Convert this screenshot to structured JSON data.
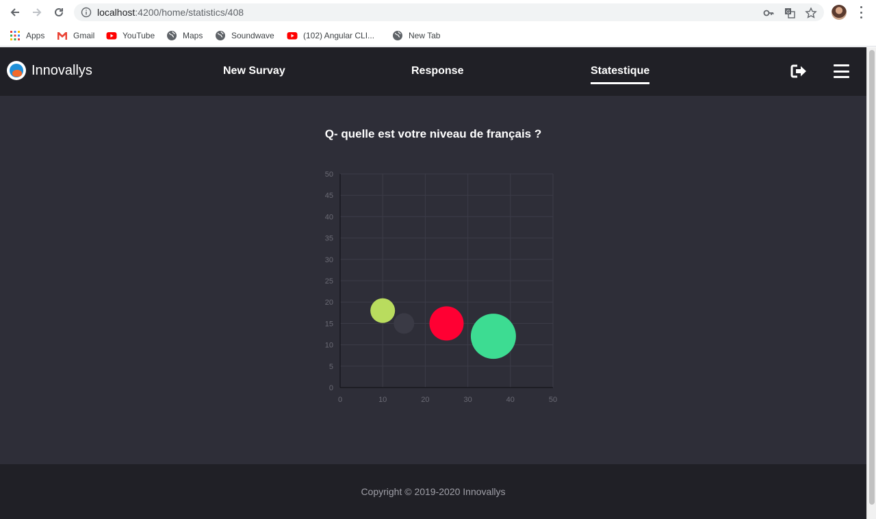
{
  "browser": {
    "url_host": "localhost",
    "url_path": ":4200/home/statistics/408",
    "bookmarks": [
      {
        "label": "Apps",
        "icon": "apps-grid-icon"
      },
      {
        "label": "Gmail",
        "icon": "gmail-icon"
      },
      {
        "label": "YouTube",
        "icon": "youtube-icon"
      },
      {
        "label": "Maps",
        "icon": "globe-icon"
      },
      {
        "label": "Soundwave",
        "icon": "globe-icon"
      },
      {
        "label": "(102) Angular CLI...",
        "icon": "youtube-icon"
      },
      {
        "label": "New Tab",
        "icon": "globe-icon"
      }
    ]
  },
  "header": {
    "brand": "Innovallys",
    "nav": [
      {
        "label": "New Survay",
        "active": false
      },
      {
        "label": "Response",
        "active": false
      },
      {
        "label": "Statestique",
        "active": true
      }
    ]
  },
  "main": {
    "question": "Q- quelle est votre niveau de français ?"
  },
  "chart_data": {
    "type": "bubble",
    "xlim": [
      0,
      50
    ],
    "ylim": [
      0,
      50
    ],
    "x_ticks": [
      0,
      10,
      20,
      30,
      40,
      50
    ],
    "y_ticks": [
      0,
      5,
      10,
      15,
      20,
      25,
      30,
      35,
      40,
      45,
      50
    ],
    "grid": true,
    "points": [
      {
        "x": 10,
        "y": 18,
        "r": 18,
        "color": "#b9dc5e"
      },
      {
        "x": 15,
        "y": 15,
        "r": 15,
        "color": "#3a3a45"
      },
      {
        "x": 25,
        "y": 15,
        "r": 25,
        "color": "#ff0033"
      },
      {
        "x": 36,
        "y": 12,
        "r": 33,
        "color": "#3ddc92"
      }
    ]
  },
  "footer": {
    "copyright": "Copyright © 2019-2020 Innovallys"
  },
  "colors": {
    "header_bg": "#202026",
    "page_bg": "#2e2e38",
    "accent": "#ffffff"
  }
}
